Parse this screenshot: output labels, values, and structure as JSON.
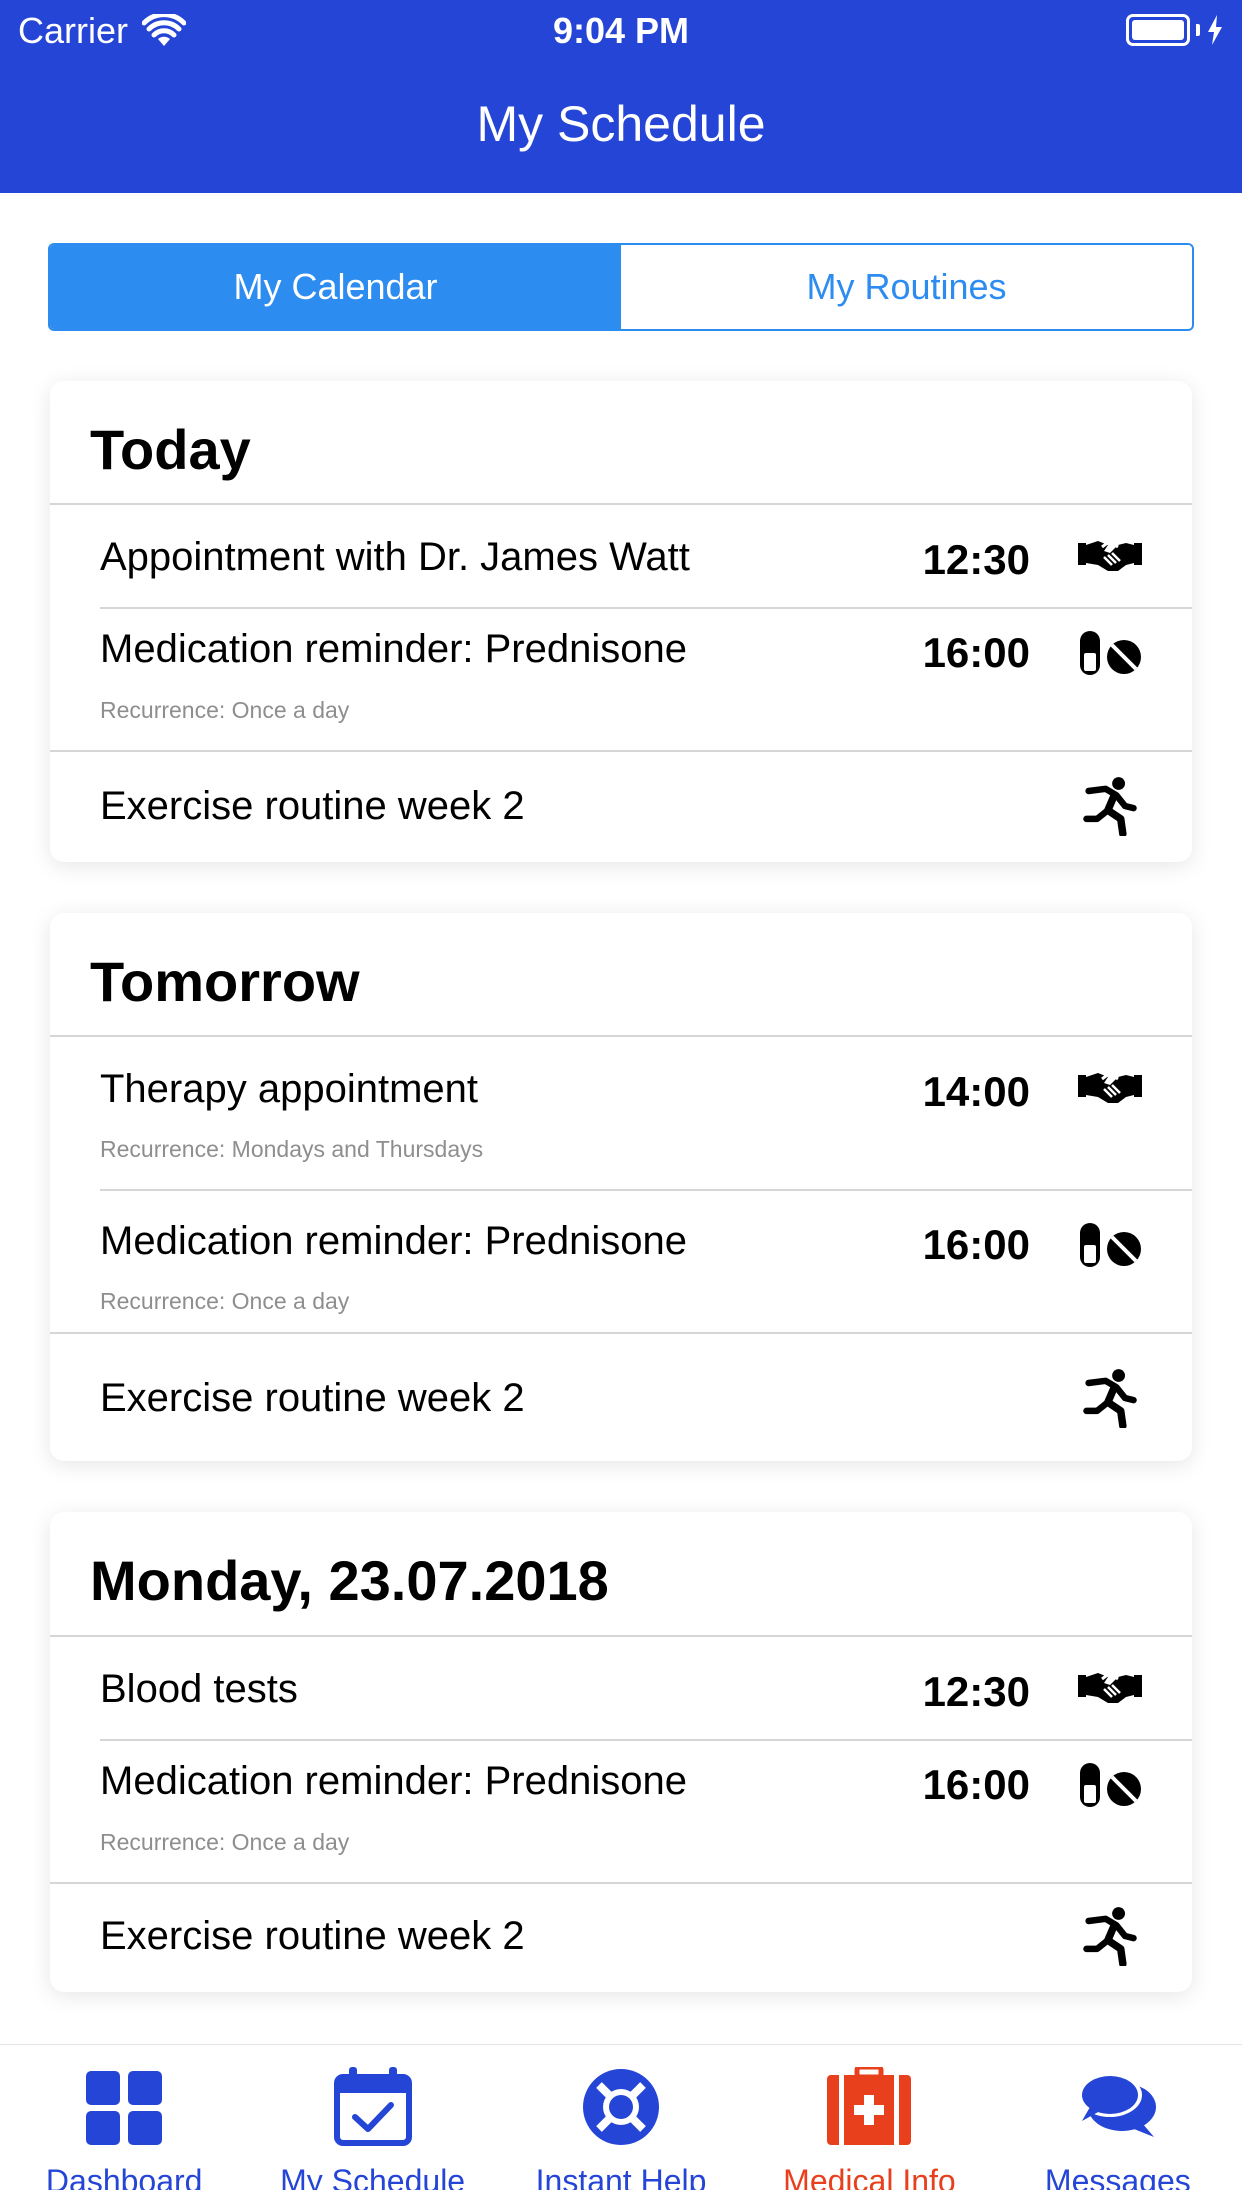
{
  "status_bar": {
    "carrier": "Carrier",
    "time": "9:04 PM"
  },
  "nav": {
    "title": "My Schedule"
  },
  "segments": [
    {
      "label": "My Calendar",
      "active": true
    },
    {
      "label": "My Routines",
      "active": false
    }
  ],
  "cards": [
    {
      "title": "Today",
      "items": [
        {
          "title": "Appointment with Dr. James Watt",
          "time": "12:30",
          "icon": "handshake-icon"
        },
        {
          "title": "Medication reminder: Prednisone",
          "subtitle": "Recurrence: Once a day",
          "time": "16:00",
          "icon": "pills-icon"
        },
        {
          "title": "Exercise routine week 2",
          "icon": "running-icon"
        }
      ]
    },
    {
      "title": "Tomorrow",
      "items": [
        {
          "title": "Therapy appointment",
          "subtitle": "Recurrence: Mondays and Thursdays",
          "time": "14:00",
          "icon": "handshake-icon"
        },
        {
          "title": "Medication reminder: Prednisone",
          "subtitle": "Recurrence: Once a day",
          "time": "16:00",
          "icon": "pills-icon"
        },
        {
          "title": "Exercise routine week 2",
          "icon": "running-icon"
        }
      ]
    },
    {
      "title": "Monday, 23.07.2018",
      "items": [
        {
          "title": "Blood tests",
          "time": "12:30",
          "icon": "handshake-icon"
        },
        {
          "title": "Medication reminder: Prednisone",
          "subtitle": "Recurrence: Once a day",
          "time": "16:00",
          "icon": "pills-icon"
        },
        {
          "title": "Exercise routine week 2",
          "icon": "running-icon"
        }
      ]
    }
  ],
  "tabbar": [
    {
      "label": "Dashboard",
      "icon": "dashboard-grid-icon",
      "color": "#2545d6"
    },
    {
      "label": "My Schedule",
      "icon": "calendar-check-icon",
      "color": "#2545d6"
    },
    {
      "label": "Instant Help",
      "icon": "lifebuoy-icon",
      "color": "#2545d6"
    },
    {
      "label": "Medical Info",
      "icon": "medical-kit-icon",
      "color": "#e8401c"
    },
    {
      "label": "Messages",
      "icon": "chat-bubbles-icon",
      "color": "#2545d6"
    }
  ],
  "colors": {
    "nav": "#2545d6",
    "segment_accent": "#2d8cf0",
    "medical": "#e8401c"
  }
}
